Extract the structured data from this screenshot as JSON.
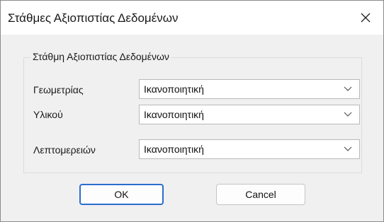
{
  "window": {
    "title": "Στάθμες Αξιοπιστίας Δεδομένων",
    "close_icon": "close-icon"
  },
  "group": {
    "legend": "Στάθμη Αξιοπιστίας Δεδομένων"
  },
  "fields": [
    {
      "label": "Γεωμετρίας",
      "value": "Ικανοποιητική"
    },
    {
      "label": "Υλικού",
      "value": "Ικανοποιητική"
    },
    {
      "label": "Λεπτομερειών",
      "value": "Ικανοποιητική"
    }
  ],
  "buttons": {
    "ok_label": "OK",
    "cancel_label": "Cancel"
  },
  "colors": {
    "dialog_bg": "#f0f0f0",
    "titlebar_bg": "#ffffff",
    "default_button_border": "#2a6ecf"
  }
}
